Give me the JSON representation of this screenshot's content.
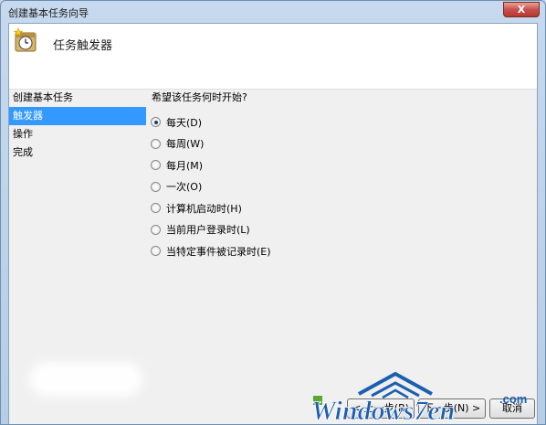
{
  "window": {
    "title": "创建基本任务向导",
    "close_glyph": "X"
  },
  "header": {
    "title": "任务触发器",
    "icon": "task-scheduler-clock-icon"
  },
  "steps": [
    {
      "label": "创建基本任务",
      "active": false
    },
    {
      "label": "触发器",
      "active": true
    },
    {
      "label": "操作",
      "active": false
    },
    {
      "label": "完成",
      "active": false
    }
  ],
  "question": "希望该任务何时开始?",
  "options": [
    {
      "label": "每天(D)",
      "checked": true
    },
    {
      "label": "每周(W)",
      "checked": false
    },
    {
      "label": "每月(M)",
      "checked": false
    },
    {
      "label": "一次(O)",
      "checked": false
    },
    {
      "label": "计算机启动时(H)",
      "checked": false
    },
    {
      "label": "当前用户登录时(L)",
      "checked": false
    },
    {
      "label": "当特定事件被记录时(E)",
      "checked": false
    }
  ],
  "buttons": {
    "back": "< 上一步(B)",
    "next": "下一步(N) >",
    "cancel": "取消"
  },
  "watermark": {
    "text": "Windows7en",
    "suffix": ".com"
  },
  "colors": {
    "selection": "#3399ff",
    "watermark_blue": "#1b5fb0",
    "watermark_green": "#5aa832"
  }
}
